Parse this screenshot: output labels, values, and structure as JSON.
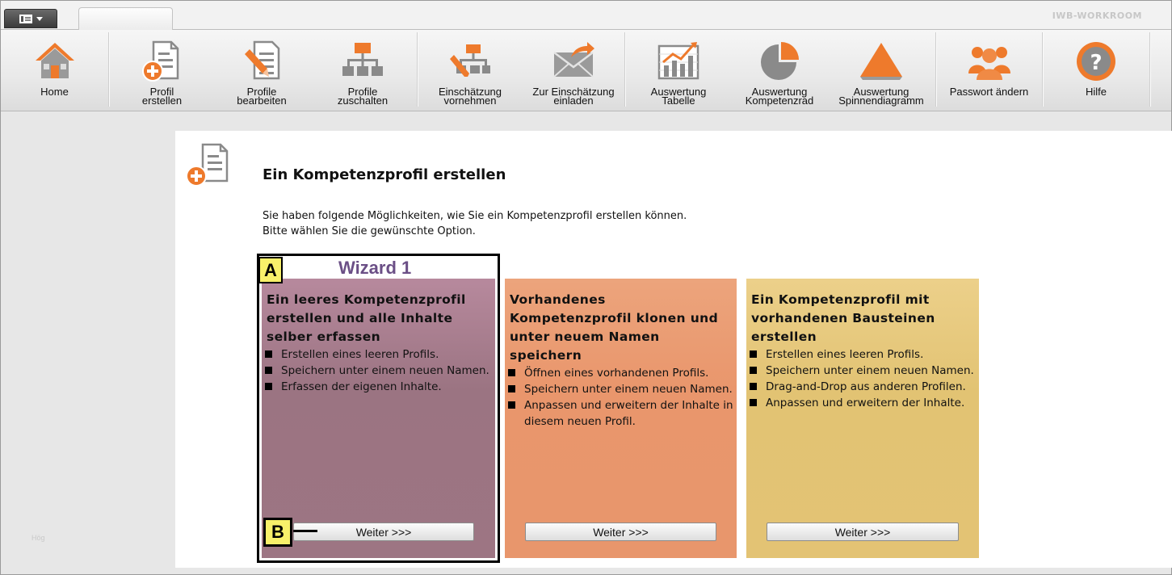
{
  "app": {
    "brand": "IWB-WORKROOM"
  },
  "toolbar": {
    "items": [
      {
        "label": "Home",
        "icon": "home-icon"
      },
      {
        "label": "Profil\nerstellen",
        "icon": "profile-add-icon"
      },
      {
        "label": "Profile\nbearbeiten",
        "icon": "profile-edit-icon"
      },
      {
        "label": "Profile\nzuschalten",
        "icon": "hierarchy-icon"
      },
      {
        "label": "Einschätzung\nvornehmen",
        "icon": "assessment-icon"
      },
      {
        "label": "Zur Einschätzung\neinladen",
        "icon": "mail-invite-icon"
      },
      {
        "label": "Auswertung\nTabelle",
        "icon": "bar-chart-icon"
      },
      {
        "label": "Auswertung\nKompetenzrad",
        "icon": "pie-chart-icon"
      },
      {
        "label": "Auswertung\nSpinnendiagramm",
        "icon": "triangle-chart-icon"
      },
      {
        "label": "Passwort ändern",
        "icon": "users-icon"
      },
      {
        "label": "Hilfe",
        "icon": "help-icon"
      }
    ]
  },
  "main": {
    "title": "Ein Kompetenzprofil erstellen",
    "intro_line1": "Sie haben folgende Möglichkeiten, wie Sie ein Kompetenzprofil erstellen können.",
    "intro_line2": "Bitte wählen Sie die gewünschte Option.",
    "side_note": "Hög",
    "cards": [
      {
        "heading": "Ein leeres Kompetenzprofil erstellen und alle Inhalte selber erfassen",
        "bullets": [
          "Erstellen eines leeren Profils.",
          "Speichern unter einem neuen Namen.",
          "Erfassen der eigenen Inhalte."
        ],
        "button": "Weiter >>>"
      },
      {
        "heading": "Vorhandenes Kompetenzprofil klonen und unter neuem Namen speichern",
        "bullets": [
          "Öffnen eines vorhandenen Profils.",
          "Speichern unter einem neuen Namen.",
          "Anpassen und erweitern der Inhalte in diesem neuen Profil."
        ],
        "button": "Weiter >>>"
      },
      {
        "heading": "Ein Kompetenzprofil mit vorhandenen Bausteinen erstellen",
        "bullets": [
          "Erstellen eines leeren Profils.",
          "Speichern unter einem neuen Namen.",
          "Drag-and-Drop aus anderen Profilen.",
          "Anpassen und erweitern der Inhalte."
        ],
        "button": "Weiter >>>"
      }
    ]
  },
  "annotations": {
    "wizard": "Wizard 1",
    "tag_a": "A",
    "tag_b": "B"
  },
  "colors": {
    "card1": "#9d7583",
    "card2": "#e8966c",
    "card3": "#e3c374",
    "icon_orange": "#ee7a2c",
    "icon_gray": "#8a8a8a",
    "wizard_text": "#6b4f86",
    "tag_yellow": "#f8f06a"
  }
}
